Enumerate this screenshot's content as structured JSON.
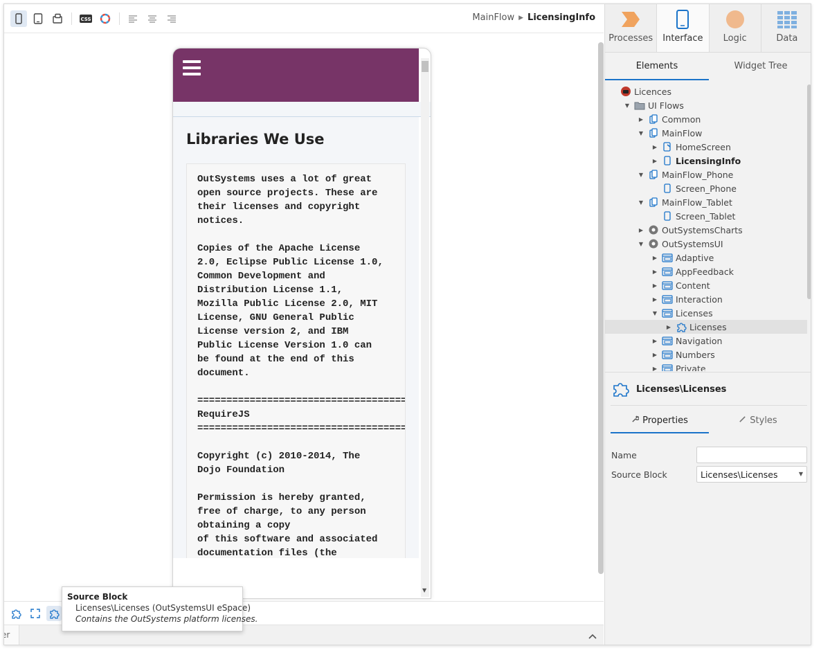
{
  "breadcrumb": {
    "parent": "MainFlow",
    "current": "LicensingInfo"
  },
  "toolbar": {
    "css_label": "CSS"
  },
  "phone": {
    "title": "Libraries We Use",
    "license_lines": [
      "OutSystems uses a lot of great",
      "open source projects. These are",
      "their licenses and copyright",
      "notices.",
      "",
      "Copies of the Apache License",
      "2.0, Eclipse Public License 1.0,",
      "Common Development and",
      "Distribution License 1.1,",
      "Mozilla Public License 2.0, MIT",
      "License, GNU General Public",
      "License version 2, and IBM",
      "Public License Version 1.0 can",
      "be found at the end of this",
      "document.",
      "",
      "=======================================",
      "RequireJS",
      "=======================================",
      "",
      "Copyright (c) 2010-2014, The",
      "Dojo Foundation",
      "",
      "Permission is hereby granted,",
      "free of charge, to any person",
      "obtaining a copy",
      "of this software and associated",
      "documentation files (the"
    ]
  },
  "tooltip": {
    "title": "Source Block",
    "line": "Licenses\\Licenses (OutSystemsUI eSpace)",
    "desc": "Contains the OutSystems platform licenses."
  },
  "status": {
    "tab_text": "er"
  },
  "right": {
    "main_tabs": [
      "Processes",
      "Interface",
      "Logic",
      "Data"
    ],
    "sub_tabs": [
      "Elements",
      "Widget Tree"
    ],
    "tree": [
      {
        "label": "Licences",
        "indent": 0,
        "caret": "",
        "icon": "app-icon",
        "bold": false
      },
      {
        "label": "UI Flows",
        "indent": 1,
        "caret": "down",
        "icon": "folder-icon",
        "bold": false
      },
      {
        "label": "Common",
        "indent": 2,
        "caret": "right",
        "icon": "flow-icon",
        "bold": false
      },
      {
        "label": "MainFlow",
        "indent": 2,
        "caret": "down",
        "icon": "flow-icon",
        "bold": false
      },
      {
        "label": "HomeScreen",
        "indent": 3,
        "caret": "right",
        "icon": "home-screen-icon",
        "bold": false
      },
      {
        "label": "LicensingInfo",
        "indent": 3,
        "caret": "right",
        "icon": "screen-icon",
        "bold": true
      },
      {
        "label": "MainFlow_Phone",
        "indent": 2,
        "caret": "down",
        "icon": "flow-icon",
        "bold": false
      },
      {
        "label": "Screen_Phone",
        "indent": 3,
        "caret": "",
        "icon": "screen-icon",
        "bold": false
      },
      {
        "label": "MainFlow_Tablet",
        "indent": 2,
        "caret": "down",
        "icon": "flow-icon",
        "bold": false
      },
      {
        "label": "Screen_Tablet",
        "indent": 3,
        "caret": "",
        "icon": "screen-icon",
        "bold": false
      },
      {
        "label": "OutSystemsCharts",
        "indent": 2,
        "caret": "right",
        "icon": "module-icon",
        "bold": false
      },
      {
        "label": "OutSystemsUI",
        "indent": 2,
        "caret": "down",
        "icon": "module-icon",
        "bold": false
      },
      {
        "label": "Adaptive",
        "indent": 3,
        "caret": "right",
        "icon": "block-folder-icon",
        "bold": false
      },
      {
        "label": "AppFeedback",
        "indent": 3,
        "caret": "right",
        "icon": "block-folder-icon",
        "bold": false
      },
      {
        "label": "Content",
        "indent": 3,
        "caret": "right",
        "icon": "block-folder-icon",
        "bold": false
      },
      {
        "label": "Interaction",
        "indent": 3,
        "caret": "right",
        "icon": "block-folder-icon",
        "bold": false
      },
      {
        "label": "Licenses",
        "indent": 3,
        "caret": "down",
        "icon": "block-folder-icon",
        "bold": false
      },
      {
        "label": "Licenses",
        "indent": 4,
        "caret": "right",
        "icon": "block-icon",
        "bold": false,
        "selected": true
      },
      {
        "label": "Navigation",
        "indent": 3,
        "caret": "right",
        "icon": "block-folder-icon",
        "bold": false
      },
      {
        "label": "Numbers",
        "indent": 3,
        "caret": "right",
        "icon": "block-folder-icon",
        "bold": false
      },
      {
        "label": "Private",
        "indent": 3,
        "caret": "right",
        "icon": "block-folder-icon",
        "bold": false
      }
    ],
    "props": {
      "title": "Licenses\\Licenses",
      "tabs": [
        "Properties",
        "Styles"
      ],
      "name_label": "Name",
      "name_value": "",
      "source_label": "Source Block",
      "source_value": "Licenses\\Licenses"
    }
  }
}
